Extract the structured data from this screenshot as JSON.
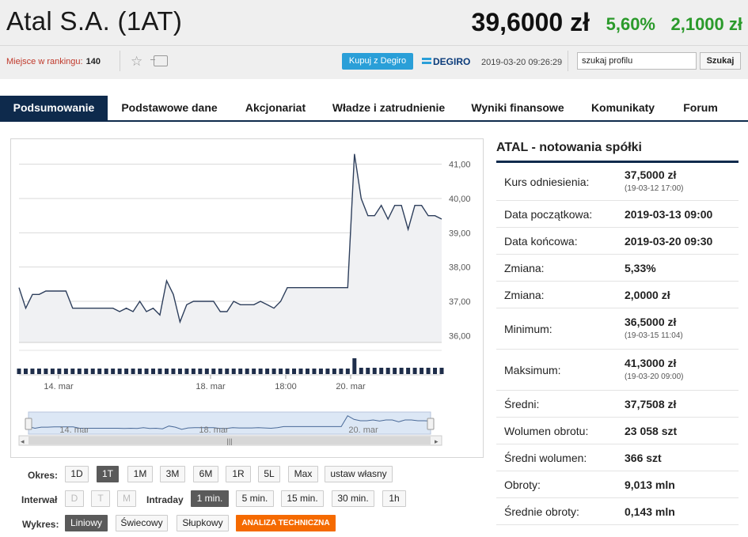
{
  "header": {
    "company": "Atal S.A. (1AT)",
    "price": "39,6000 zł",
    "change_pct": "5,60%",
    "change_abs": "2,1000 zł",
    "rank_label": "Miejsce w rankingu:",
    "rank_value": "140",
    "degiro_button": "Kupuj z Degiro",
    "degiro_logo": "DEGIRO",
    "timestamp": "2019-03-20 09:26:29",
    "search_value": "szukaj profilu",
    "search_button": "Szukaj"
  },
  "tabs": [
    "Podsumowanie",
    "Podstawowe dane",
    "Akcjonariat",
    "Władze i zatrudnienie",
    "Wyniki finansowe",
    "Komunikaty",
    "Forum"
  ],
  "chart_data": {
    "type": "line",
    "y_ticks": [
      "41,00",
      "40,00",
      "39,00",
      "38,00",
      "37,00",
      "36,00"
    ],
    "ylim": [
      35.8,
      41.5
    ],
    "x_labels": [
      "14. mar",
      "18. mar",
      "18:00",
      "20. mar"
    ],
    "navigator_labels": [
      "14. mar",
      "18. mar",
      "20. mar"
    ],
    "series": [
      {
        "values": [
          37.4,
          36.8,
          37.2,
          37.2,
          37.3,
          37.3,
          37.3,
          37.3,
          36.8,
          36.8,
          36.8,
          36.8,
          36.8,
          36.8,
          36.8,
          36.7,
          36.8,
          36.7,
          37.0,
          36.7,
          36.8,
          36.6,
          37.6,
          37.2,
          36.4,
          36.9,
          37.0,
          37.0,
          37.0,
          37.0,
          36.7,
          36.7,
          37.0,
          36.9,
          36.9,
          36.9,
          37.0,
          36.9,
          36.8,
          37.0,
          37.4,
          37.4,
          37.4,
          37.4,
          37.4,
          37.4,
          37.4,
          37.4,
          37.4,
          37.4,
          41.3,
          40.0,
          39.5,
          39.5,
          39.8,
          39.4,
          39.8,
          39.8,
          39.1,
          39.8,
          39.8,
          39.5,
          39.5,
          39.4
        ],
        "volume": [
          7,
          7,
          7,
          7,
          7,
          7,
          7,
          7,
          7,
          7,
          7,
          7,
          7,
          7,
          7,
          7,
          7,
          7,
          7,
          7,
          7,
          7,
          7,
          7,
          7,
          7,
          7,
          7,
          7,
          7,
          7,
          7,
          7,
          7,
          7,
          7,
          7,
          7,
          7,
          7,
          7,
          7,
          7,
          7,
          7,
          7,
          7,
          7,
          7,
          7,
          20,
          8,
          8,
          8,
          8,
          8,
          8,
          8,
          8,
          8,
          8,
          8,
          8,
          8
        ]
      }
    ]
  },
  "controls": {
    "okres_label": "Okres:",
    "okres": [
      "1D",
      "1T",
      "1M",
      "3M",
      "6M",
      "1R",
      "5L",
      "Max",
      "ustaw własny"
    ],
    "interwal_label": "Interwał",
    "interwal": [
      "D",
      "T",
      "M"
    ],
    "intraday_label": "Intraday",
    "intraday": [
      "1 min.",
      "5 min.",
      "15 min.",
      "30 min.",
      "1h"
    ],
    "wykres_label": "Wykres:",
    "wykres": [
      "Liniowy",
      "Świecowy",
      "Słupkowy"
    ],
    "analiza": "ANALIZA TECHNICZNA"
  },
  "side": {
    "title": "ATAL - notowania spółki",
    "rows": [
      {
        "label": "Kurs odniesienia:",
        "value": "37,5000 zł",
        "sub": "(19-03-12 17:00)"
      },
      {
        "label": "Data początkowa:",
        "value": "2019-03-13 09:00",
        "sub": ""
      },
      {
        "label": "Data końcowa:",
        "value": "2019-03-20 09:30",
        "sub": ""
      },
      {
        "label": "Zmiana:",
        "value": "5,33%",
        "sub": ""
      },
      {
        "label": "Zmiana:",
        "value": "2,0000 zł",
        "sub": ""
      },
      {
        "label": "Minimum:",
        "value": "36,5000 zł",
        "sub": "(19-03-15 11:04)"
      },
      {
        "label": "Maksimum:",
        "value": "41,3000 zł",
        "sub": "(19-03-20 09:00)"
      },
      {
        "label": "Średni:",
        "value": "37,7508 zł",
        "sub": ""
      },
      {
        "label": "Wolumen obrotu:",
        "value": "23 058 szt",
        "sub": ""
      },
      {
        "label": "Średni wolumen:",
        "value": "366 szt",
        "sub": ""
      },
      {
        "label": "Obroty:",
        "value": "9,013 mln",
        "sub": ""
      },
      {
        "label": "Średnie obroty:",
        "value": "0,143 mln",
        "sub": ""
      }
    ]
  }
}
